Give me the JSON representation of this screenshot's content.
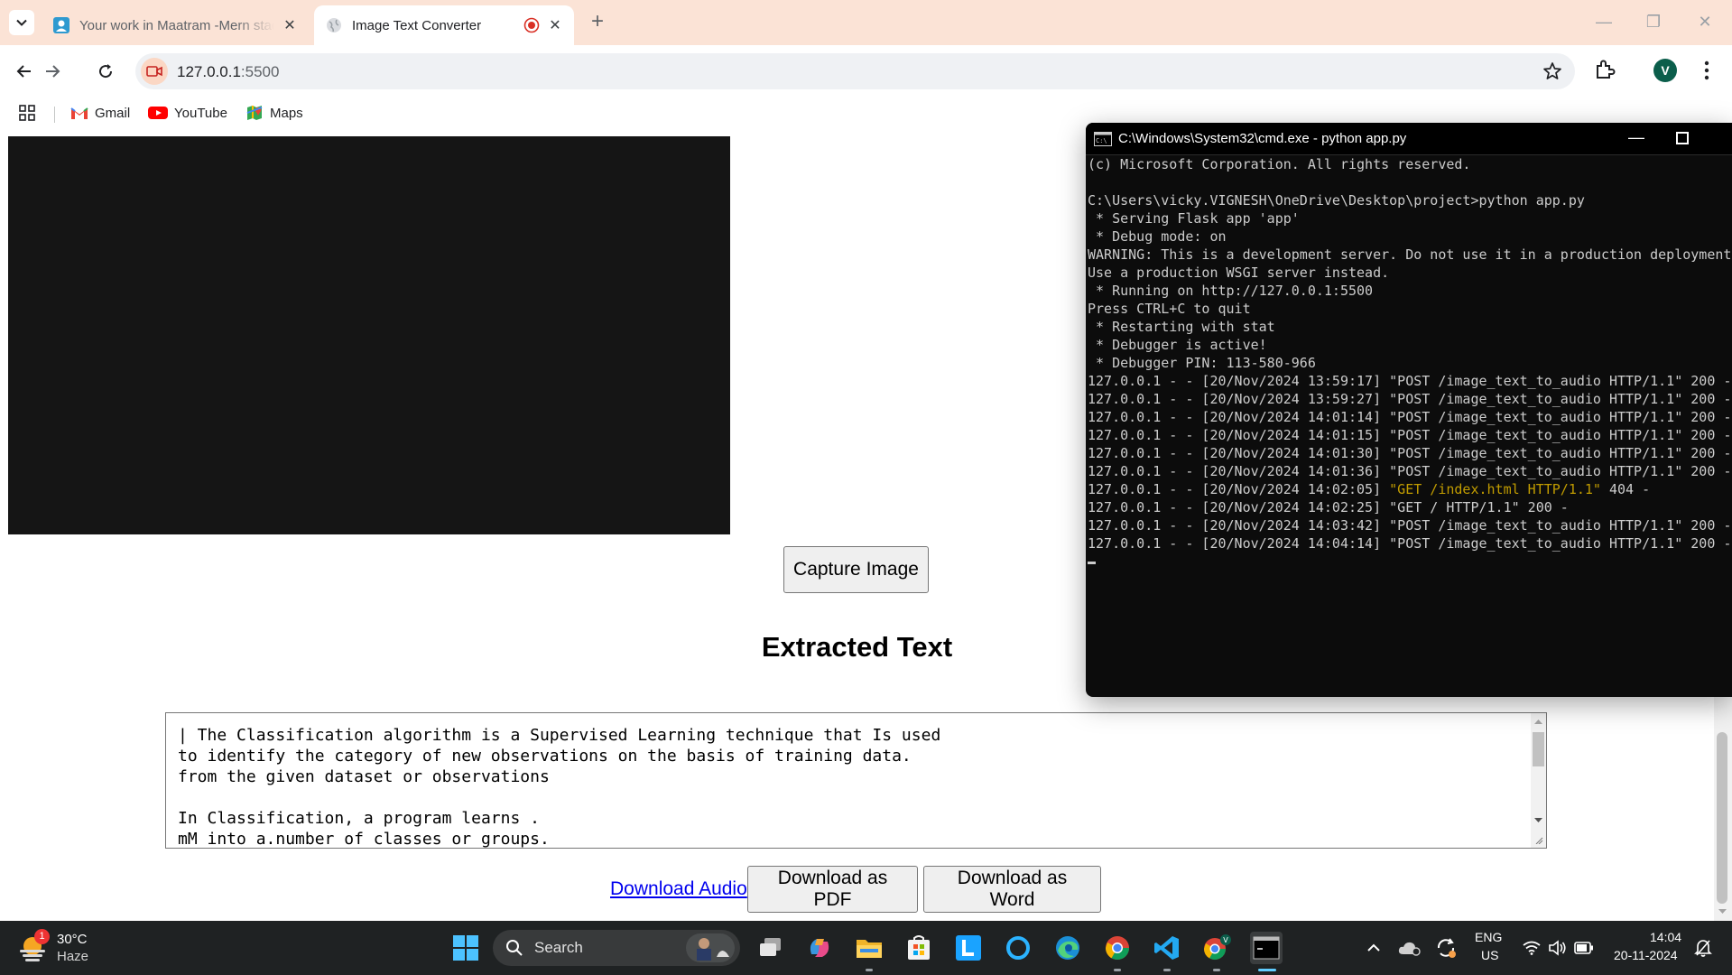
{
  "browser": {
    "tabs": [
      {
        "title": "Your work in Maatram -Mern stack",
        "active": false
      },
      {
        "title": "Image Text Converter",
        "active": true
      }
    ],
    "url": {
      "host": "127.0.0.1",
      "port": ":5500"
    },
    "profile_initial": "V",
    "bookmarks": [
      {
        "label": "Gmail",
        "icon": "gmail-icon"
      },
      {
        "label": "YouTube",
        "icon": "youtube-icon"
      },
      {
        "label": "Maps",
        "icon": "maps-icon"
      }
    ]
  },
  "page": {
    "capture_button": "Capture Image",
    "heading": "Extracted Text",
    "extracted_text": "| The Classification algorithm is a Supervised Learning technique that Is used\nto identify the category of new observations on the basis of training data.\nfrom the given dataset or observations\n\nIn Classification, a program learns .\nmM into a.number of classes or groups.",
    "download_audio": "Download Audio",
    "download_pdf": "Download as PDF",
    "download_word": "Download as Word"
  },
  "cmd": {
    "title": "C:\\Windows\\System32\\cmd.exe - python  app.py",
    "lines": [
      {
        "text": "(c) Microsoft Corporation. All rights reserved.",
        "color": "default"
      },
      {
        "text": "",
        "color": "default"
      },
      {
        "text": "C:\\Users\\vicky.VIGNESH\\OneDrive\\Desktop\\project>python app.py",
        "color": "default"
      },
      {
        "text": " * Serving Flask app 'app'",
        "color": "default"
      },
      {
        "text": " * Debug mode: on",
        "color": "default"
      },
      {
        "text": "WARNING: This is a development server. Do not use it in a production deployment.",
        "color": "red"
      },
      {
        "text": "Use a production WSGI server instead.",
        "color": "red"
      },
      {
        "text": " * Running on http://127.0.0.1:5500",
        "color": "default"
      },
      {
        "text": "Press CTRL+C to quit",
        "color": "yellow"
      },
      {
        "text": " * Restarting with stat",
        "color": "default"
      },
      {
        "text": " * Debugger is active!",
        "color": "default"
      },
      {
        "text": " * Debugger PIN: 113-580-966",
        "color": "default"
      },
      {
        "text": "127.0.0.1 - - [20/Nov/2024 13:59:17] \"POST /image_text_to_audio HTTP/1.1\" 200 -",
        "color": "default"
      },
      {
        "text": "127.0.0.1 - - [20/Nov/2024 13:59:27] \"POST /image_text_to_audio HTTP/1.1\" 200 -",
        "color": "default"
      },
      {
        "text": "127.0.0.1 - - [20/Nov/2024 14:01:14] \"POST /image_text_to_audio HTTP/1.1\" 200 -",
        "color": "default"
      },
      {
        "text": "127.0.0.1 - - [20/Nov/2024 14:01:15] \"POST /image_text_to_audio HTTP/1.1\" 200 -",
        "color": "default"
      },
      {
        "text": "127.0.0.1 - - [20/Nov/2024 14:01:30] \"POST /image_text_to_audio HTTP/1.1\" 200 -",
        "color": "default"
      },
      {
        "text": "127.0.0.1 - - [20/Nov/2024 14:01:36] \"POST /image_text_to_audio HTTP/1.1\" 200 -",
        "color": "default"
      },
      {
        "text": "127.0.0.1 - - [20/Nov/2024 14:02:05] ",
        "color": "default",
        "highlight": "\"GET /index.html HTTP/1.1\"",
        "tail": " 404 -"
      },
      {
        "text": "127.0.0.1 - - [20/Nov/2024 14:02:25] \"GET / HTTP/1.1\" 200 -",
        "color": "default"
      },
      {
        "text": "127.0.0.1 - - [20/Nov/2024 14:03:42] \"POST /image_text_to_audio HTTP/1.1\" 200 -",
        "color": "default"
      },
      {
        "text": "127.0.0.1 - - [20/Nov/2024 14:04:14] \"POST /image_text_to_audio HTTP/1.1\" 200 -",
        "color": "default"
      }
    ]
  },
  "taskbar": {
    "weather_temp": "30°C",
    "weather_desc": "Haze",
    "weather_badge": "1",
    "search_label": "Search",
    "language": "ENG",
    "region": "US",
    "time": "14:04",
    "date": "20-11-2024",
    "apps": [
      "windows-start-icon",
      "task-view-icon",
      "copilot-icon",
      "file-explorer-icon",
      "microsoft-store-icon",
      "l-app-icon",
      "cortana-icon",
      "edge-icon",
      "chrome-icon",
      "vscode-icon",
      "chrome-profile-icon",
      "terminal-icon"
    ]
  },
  "colors": {
    "tabstrip": "#fbe3d6",
    "terminal_bg": "#0c0c0c",
    "terminal_red": "#e74856",
    "terminal_yellow": "#c19c00",
    "taskbar": "#1f2223",
    "link": "#0000ee"
  }
}
